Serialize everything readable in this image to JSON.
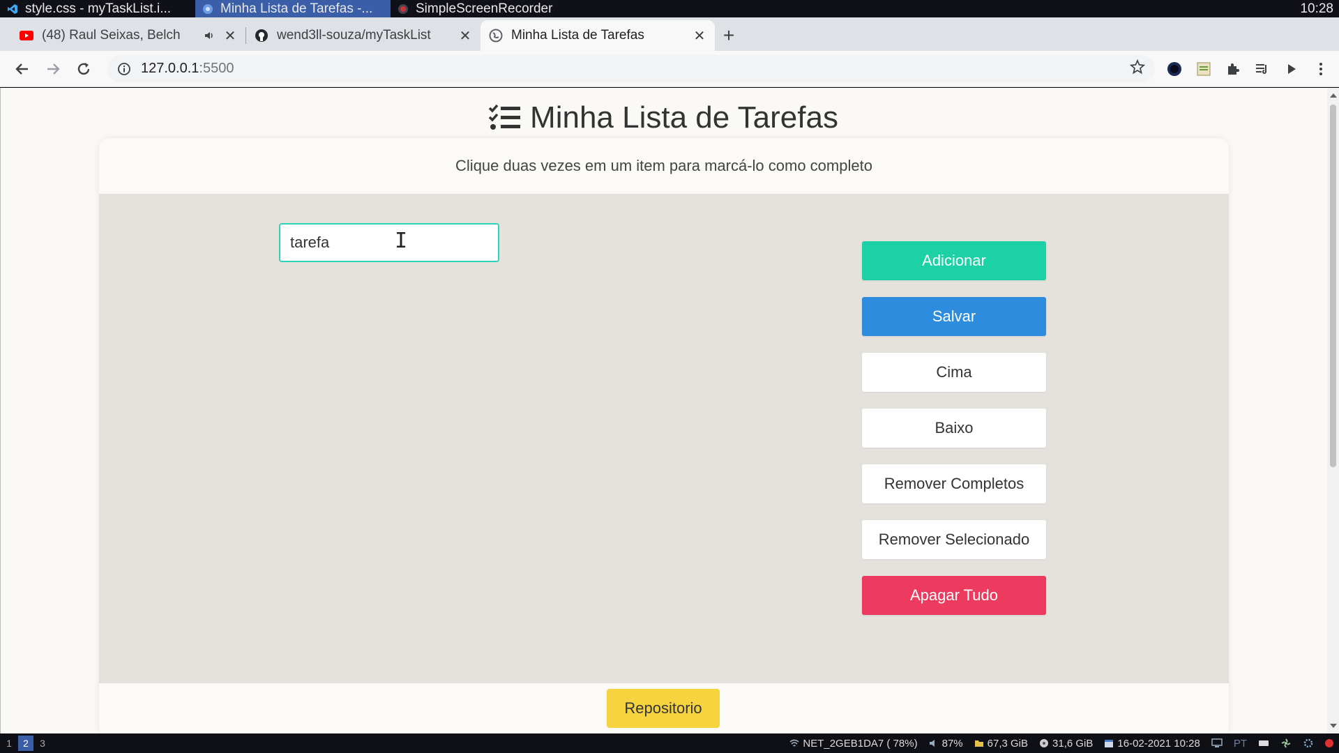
{
  "os": {
    "tasks": [
      "style.css - myTaskList.i...",
      "Minha Lista de Tarefas -...",
      "SimpleScreenRecorder"
    ],
    "clock": "10:28",
    "workspaces": [
      "1",
      "2",
      "3"
    ],
    "tray": {
      "network": "NET_2GEB1DA7 ( 78%)",
      "volume": "87%",
      "disk1": "67,3 GiB",
      "disk2": "31,6 GiB",
      "datetime": "16-02-2021 10:28",
      "lang": "PT"
    }
  },
  "browser": {
    "tabs": [
      {
        "title": "(48) Raul Seixas, Belch"
      },
      {
        "title": "wend3ll-souza/myTaskList"
      },
      {
        "title": "Minha Lista de Tarefas"
      }
    ],
    "url_host": "127.0.0.1",
    "url_port": ":5500"
  },
  "page": {
    "title": "Minha Lista de Tarefas",
    "instructions": "Clique duas vezes em um item para marcá-lo como completo",
    "input_value": "tarefa",
    "buttons": {
      "add": "Adicionar",
      "save": "Salvar",
      "up": "Cima",
      "down": "Baixo",
      "remove_done": "Remover Completos",
      "remove_selected": "Remover Selecionado",
      "clear": "Apagar Tudo"
    },
    "repo": "Repositorio"
  },
  "colors": {
    "add": "#1bd1a5",
    "save": "#2e8cde",
    "clear": "#ec3b5e",
    "repo": "#f6d33f",
    "input_border": "#2fd3b7"
  }
}
